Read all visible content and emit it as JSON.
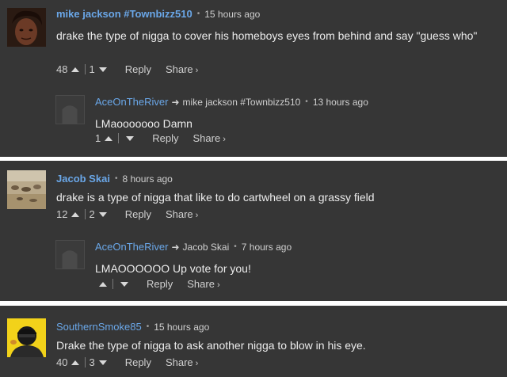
{
  "comments": [
    {
      "author": "mike jackson #Townbizz510",
      "time": "15 hours ago",
      "text": "drake the type of nigga to cover his homeboys eyes from behind and say \"guess who\"",
      "upvotes": "48",
      "downvotes": "1",
      "reply_label": "Reply",
      "share_label": "Share",
      "replies": [
        {
          "author": "AceOnTheRiver",
          "reply_to": "mike jackson #Townbizz510",
          "time": "13 hours ago",
          "text": "LMaooooooo Damn",
          "upvotes": "1",
          "downvotes": "",
          "reply_label": "Reply",
          "share_label": "Share"
        }
      ]
    },
    {
      "author": "Jacob Skai",
      "time": "8 hours ago",
      "text": "drake is a type of nigga that like to do cartwheel on a grassy field",
      "upvotes": "12",
      "downvotes": "2",
      "reply_label": "Reply",
      "share_label": "Share",
      "replies": [
        {
          "author": "AceOnTheRiver",
          "reply_to": "Jacob Skai",
          "time": "7 hours ago",
          "text": "LMAOOOOOO Up vote for you!",
          "upvotes": "",
          "downvotes": "",
          "reply_label": "Reply",
          "share_label": "Share"
        }
      ]
    },
    {
      "author": "SouthernSmoke85",
      "time": "15 hours ago",
      "text": "Drake the type of nigga to ask another nigga to blow in his eye.",
      "upvotes": "40",
      "downvotes": "3",
      "reply_label": "Reply",
      "share_label": "Share",
      "replies": []
    }
  ],
  "icons": {
    "upvote": "up-arrow-icon",
    "downvote": "down-arrow-icon",
    "reply_to": "right-arrow-icon",
    "share_chevron": "chevron-right-icon"
  },
  "colors": {
    "panel_bg": "#363636",
    "author": "#6aa7e8",
    "text": "#ececec"
  }
}
